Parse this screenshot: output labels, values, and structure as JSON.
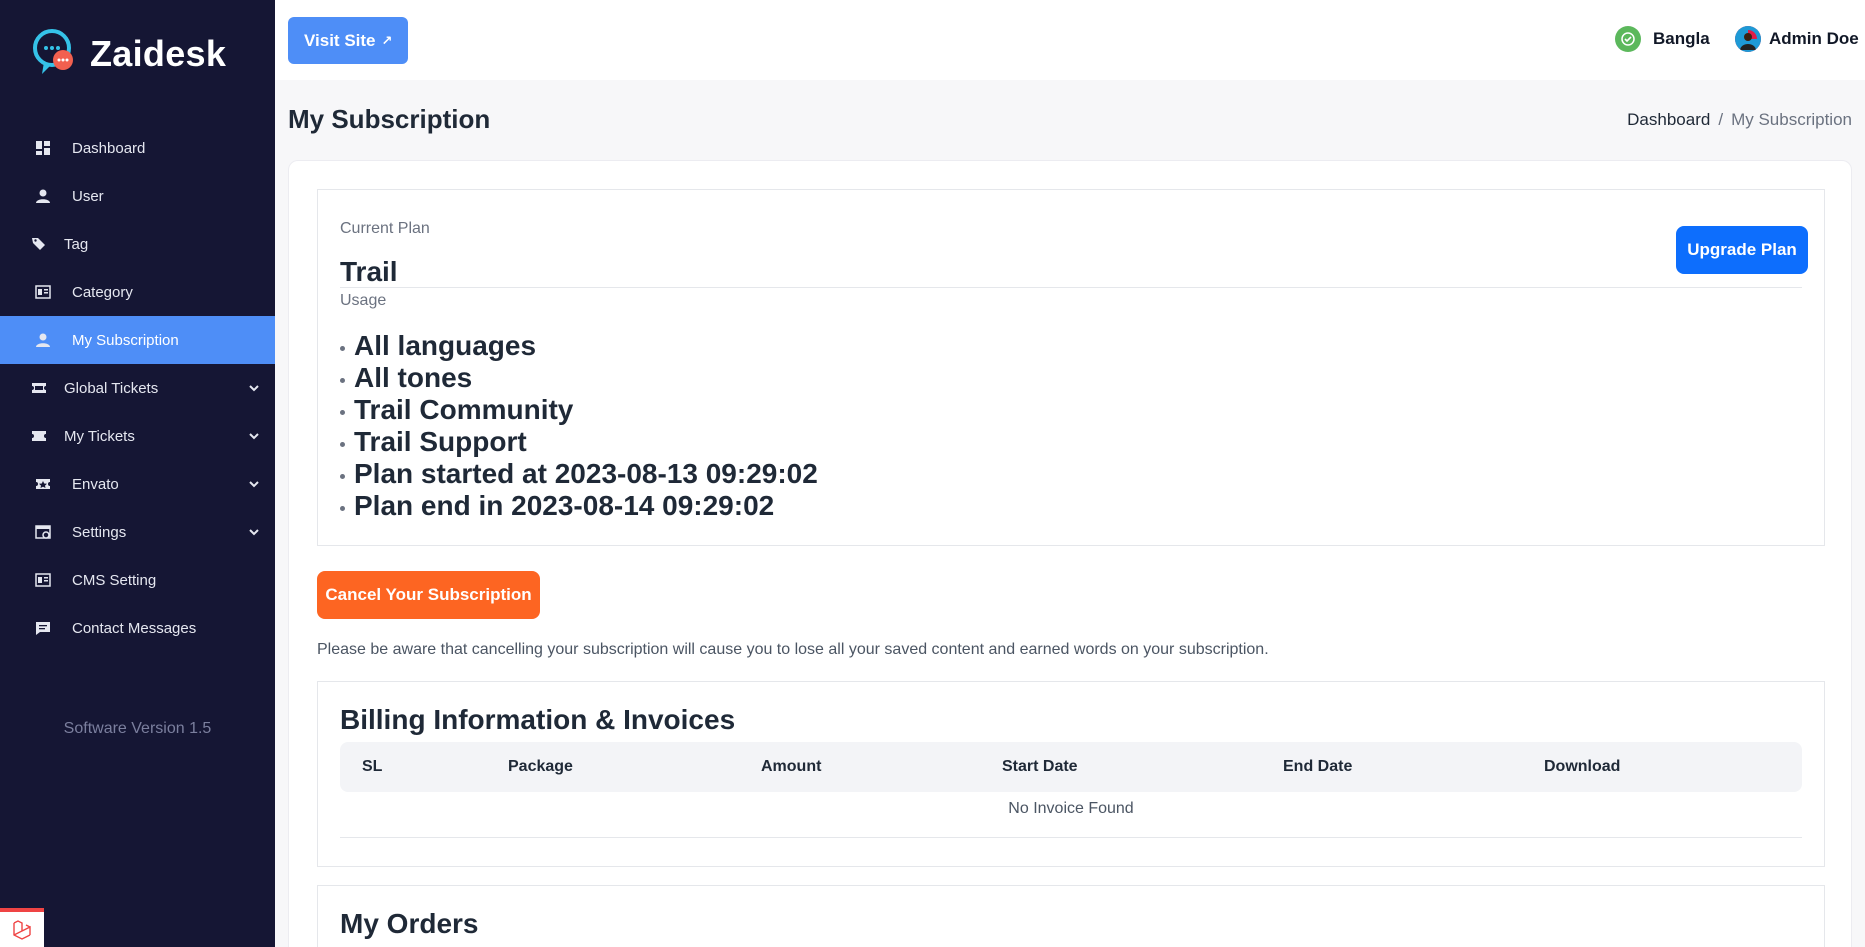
{
  "brand": {
    "name": "Zaidesk"
  },
  "sidebar": {
    "items": [
      {
        "label": "Dashboard",
        "icon": "dashboard-icon",
        "active": false,
        "has_chevron": false
      },
      {
        "label": "User",
        "icon": "user-icon",
        "active": false,
        "has_chevron": false
      },
      {
        "label": "Tag",
        "icon": "tag-icon",
        "active": false,
        "has_chevron": false
      },
      {
        "label": "Category",
        "icon": "category-icon",
        "active": false,
        "has_chevron": false
      },
      {
        "label": "My Subscription",
        "icon": "user-icon",
        "active": true,
        "has_chevron": false
      },
      {
        "label": "Global Tickets",
        "icon": "ticket-icon",
        "active": false,
        "has_chevron": true
      },
      {
        "label": "My Tickets",
        "icon": "ticket-icon",
        "active": false,
        "has_chevron": true
      },
      {
        "label": "Envato",
        "icon": "envato-icon",
        "active": false,
        "has_chevron": true
      },
      {
        "label": "Settings",
        "icon": "settings-icon",
        "active": false,
        "has_chevron": true
      },
      {
        "label": "CMS Setting",
        "icon": "cms-icon",
        "active": false,
        "has_chevron": false
      },
      {
        "label": "Contact Messages",
        "icon": "message-icon",
        "active": false,
        "has_chevron": false
      }
    ],
    "version": "Software Version 1.5"
  },
  "topbar": {
    "visit_site": "Visit Site",
    "language": "Bangla",
    "user_name": "Admin Doe"
  },
  "page": {
    "title": "My Subscription",
    "breadcrumb": {
      "home": "Dashboard",
      "separator": "/",
      "current": "My Subscription"
    }
  },
  "plan": {
    "current_label": "Current Plan",
    "name": "Trail",
    "usage_label": "Usage",
    "upgrade_button": "Upgrade Plan",
    "features": [
      "All languages",
      "All tones",
      "Trail Community",
      "Trail Support",
      "Plan started at 2023-08-13 09:29:02",
      "Plan end in 2023-08-14 09:29:02"
    ]
  },
  "cancel": {
    "button": "Cancel Your Subscription",
    "warning": "Please be aware that cancelling your subscription will cause you to lose all your saved content and earned words on your subscription."
  },
  "billing": {
    "title": "Billing Information & Invoices",
    "columns": [
      "SL",
      "Package",
      "Amount",
      "Start Date",
      "End Date",
      "Download"
    ],
    "empty_text": "No Invoice Found"
  },
  "orders": {
    "title": "My Orders"
  },
  "colors": {
    "sidebar_bg": "#151634",
    "accent": "#4e8ef7",
    "primary_button": "#0d6efd",
    "danger_button": "#fd6522"
  }
}
